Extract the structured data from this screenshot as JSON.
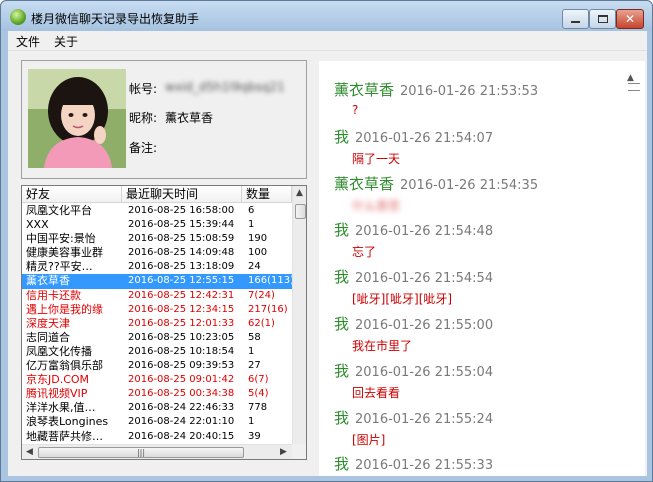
{
  "window": {
    "title": "楼月微信聊天记录导出恢复助手",
    "close_glyph": "✕"
  },
  "menu": {
    "items": [
      "文件",
      "关于"
    ]
  },
  "profile": {
    "account_label": "帐号:",
    "account_value": "wxid_d5h1l9qbsq21",
    "nickname_label": "昵称:",
    "nickname_value": "薰衣草香",
    "remark_label": "备注:",
    "remark_value": ""
  },
  "friends": {
    "columns": [
      "好友",
      "最近聊天时间",
      "数量"
    ],
    "rows": [
      {
        "name": "凤凰文化平台",
        "time": "2016-08-25 16:58:00",
        "count": "6",
        "style": "normal"
      },
      {
        "name": "XXX",
        "time": "2016-08-25 15:39:44",
        "count": "1",
        "style": "normal"
      },
      {
        "name": "中国平安:景怡",
        "time": "2016-08-25 15:08:59",
        "count": "190",
        "style": "normal"
      },
      {
        "name": "健康美容事业群",
        "time": "2016-08-25 14:09:48",
        "count": "100",
        "style": "normal"
      },
      {
        "name": "精灵??平安…",
        "time": "2016-08-25 13:18:09",
        "count": "24",
        "style": "normal"
      },
      {
        "name": "薰衣草香",
        "time": "2016-08-25 12:55:15",
        "count": "166(113)",
        "style": "selected"
      },
      {
        "name": "信用卡还款",
        "time": "2016-08-25 12:42:31",
        "count": "7(24)",
        "style": "red"
      },
      {
        "name": "遇上你是我的缘",
        "time": "2016-08-25 12:34:15",
        "count": "217(16)",
        "style": "red"
      },
      {
        "name": "深度天津",
        "time": "2016-08-25 12:01:33",
        "count": "62(1)",
        "style": "red"
      },
      {
        "name": "志同道合",
        "time": "2016-08-25 10:23:05",
        "count": "58",
        "style": "normal"
      },
      {
        "name": "凤凰文化传播",
        "time": "2016-08-25 10:18:54",
        "count": "1",
        "style": "normal"
      },
      {
        "name": "亿万富翁俱乐部",
        "time": "2016-08-25 09:39:53",
        "count": "27",
        "style": "normal"
      },
      {
        "name": "京东JD.COM",
        "time": "2016-08-25 09:01:42",
        "count": "6(7)",
        "style": "red"
      },
      {
        "name": "腾讯视频VIP",
        "time": "2016-08-25 00:34:38",
        "count": "5(4)",
        "style": "red"
      },
      {
        "name": "洋洋水果,值…",
        "time": "2016-08-24 22:46:33",
        "count": "778",
        "style": "normal"
      },
      {
        "name": "浪琴表Longines",
        "time": "2016-08-24 22:01:10",
        "count": "1",
        "style": "normal"
      },
      {
        "name": "地藏菩萨共修…",
        "time": "2016-08-24 20:40:15",
        "count": "39",
        "style": "normal"
      }
    ]
  },
  "chat": {
    "messages": [
      {
        "sender": "薰衣草香",
        "time": "2016-01-26 21:53:53",
        "text": "?",
        "blurred": false
      },
      {
        "sender": "我",
        "time": "2016-01-26 21:54:07",
        "text": "隔了一天",
        "blurred": false
      },
      {
        "sender": "薰衣草香",
        "time": "2016-01-26 21:54:35",
        "text": "什么意思",
        "blurred": true
      },
      {
        "sender": "我",
        "time": "2016-01-26 21:54:48",
        "text": "忘了",
        "blurred": false
      },
      {
        "sender": "我",
        "time": "2016-01-26 21:54:54",
        "text": "[呲牙][呲牙][呲牙]",
        "blurred": false
      },
      {
        "sender": "我",
        "time": "2016-01-26 21:55:00",
        "text": "我在市里了",
        "blurred": false
      },
      {
        "sender": "我",
        "time": "2016-01-26 21:55:04",
        "text": "回去看看",
        "blurred": false
      },
      {
        "sender": "我",
        "time": "2016-01-26 21:55:24",
        "text": "[图片]",
        "blurred": false
      },
      {
        "sender": "我",
        "time": "2016-01-26 21:55:33",
        "text": "",
        "blurred": false
      }
    ]
  },
  "colors": {
    "sender_green": "#2e8b2e",
    "message_red": "#cc0000",
    "selection_blue": "#3399ff",
    "unread_red": "#e00000"
  }
}
